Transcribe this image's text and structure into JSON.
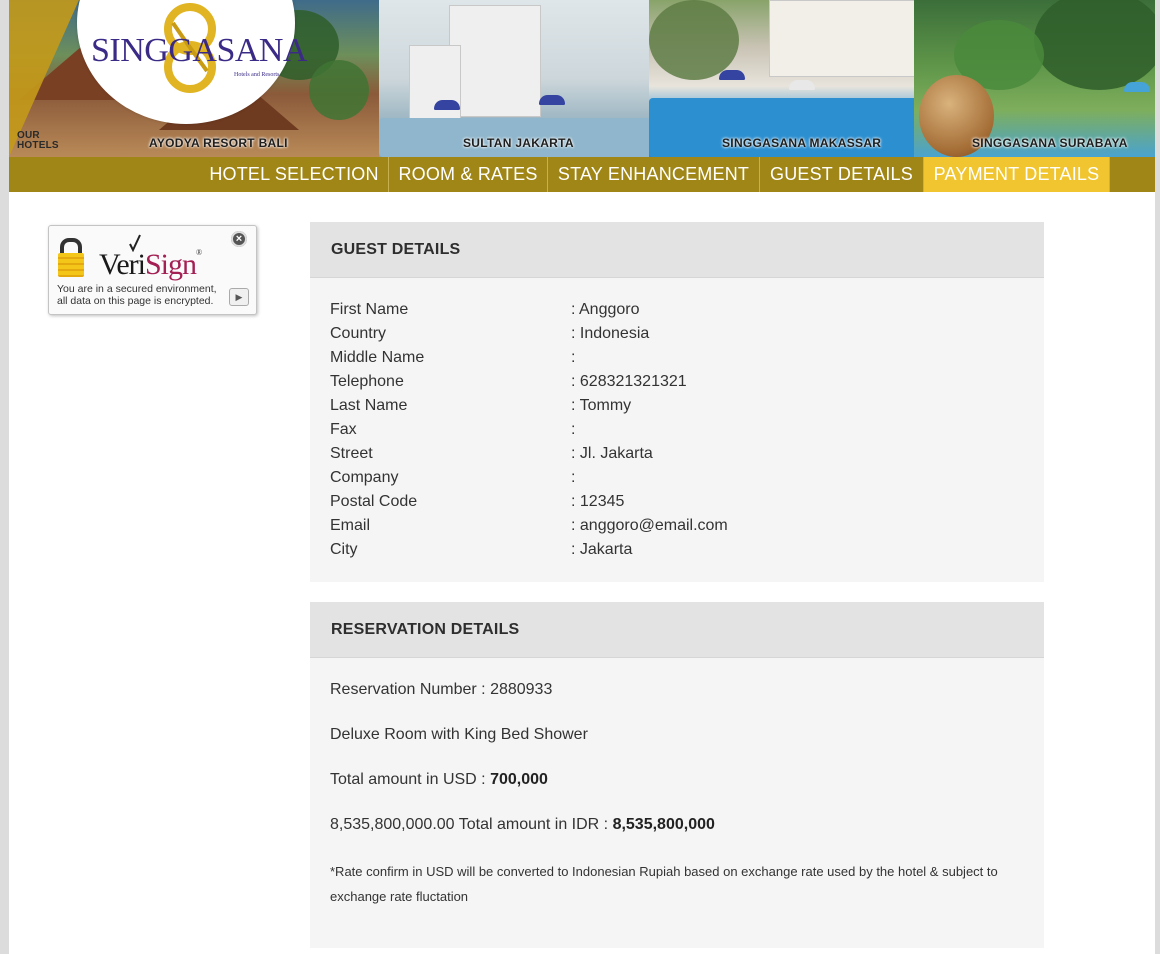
{
  "banner": {
    "logo_text": "SINGGASANA",
    "logo_subtext": "Hotels and Resorts",
    "our_hotels_label": [
      "OUR",
      "HOTELS"
    ],
    "hotels": [
      "AYODYA RESORT BALI",
      "SULTAN JAKARTA",
      "SINGGASANA MAKASSAR",
      "SINGGASANA SURABAYA"
    ]
  },
  "nav": {
    "items": [
      {
        "label": "HOTEL SELECTION",
        "active": false
      },
      {
        "label": "ROOM & RATES",
        "active": false
      },
      {
        "label": "STAY ENHANCEMENT",
        "active": false
      },
      {
        "label": "GUEST DETAILS",
        "active": false
      },
      {
        "label": "PAYMENT DETAILS",
        "active": true
      }
    ]
  },
  "verisign": {
    "logo_veri": "Veri",
    "logo_sign": "Sign",
    "registered": "®",
    "close": "×",
    "play": "▶",
    "secure_text": "You are in a secured environment, all data on this page is encrypted."
  },
  "guest_details": {
    "title": "GUEST DETAILS",
    "rows": [
      {
        "label": "First Name",
        "value": ": Anggoro"
      },
      {
        "label": "Country",
        "value": ": Indonesia"
      },
      {
        "label": "Middle Name",
        "value": ":"
      },
      {
        "label": "Telephone",
        "value": ": 628321321321"
      },
      {
        "label": "Last Name",
        "value": ": Tommy"
      },
      {
        "label": "Fax",
        "value": ":"
      },
      {
        "label": "Street",
        "value": ": Jl. Jakarta"
      },
      {
        "label": "Company",
        "value": ":"
      },
      {
        "label": "Postal Code",
        "value": ": 12345"
      },
      {
        "label": "Email",
        "value": ": anggoro@email.com"
      },
      {
        "label": "City",
        "value": ": Jakarta"
      }
    ]
  },
  "reservation_details": {
    "title": "RESERVATION DETAILS",
    "reservation_number_label": "Reservation Number : ",
    "reservation_number": "2880933",
    "room": "Deluxe Room with King Bed Shower",
    "usd_label": "Total amount in USD : ",
    "usd_amount": "700,000",
    "idr_label": "8,535,800,000.00 Total amount in IDR : ",
    "idr_amount": "8,535,800,000",
    "note": "*Rate confirm in USD will be converted to Indonesian Rupiah based on exchange rate used by the hotel & subject to exchange rate fluctation"
  },
  "colors": {
    "nav_bar": "#a08617",
    "nav_active": "#f0c530",
    "panel_bg": "#f5f5f5",
    "panel_header": "#e3e3e3",
    "logo": "#3b2b87"
  }
}
